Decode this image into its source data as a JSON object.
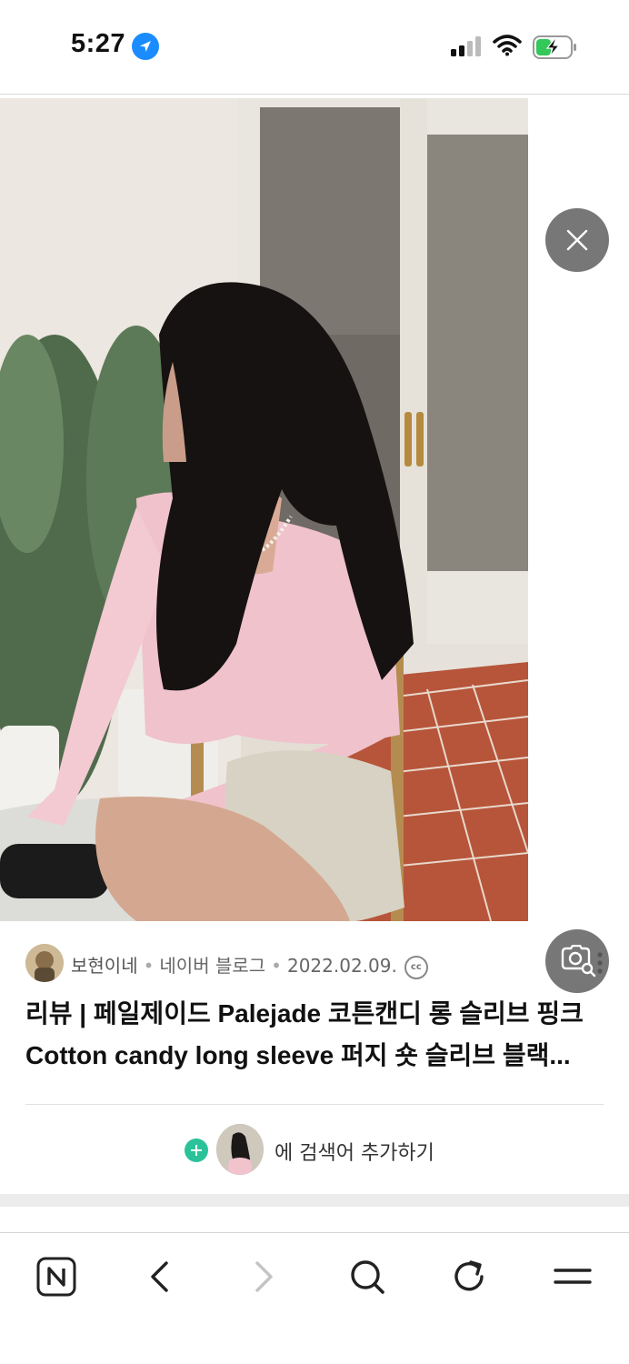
{
  "status_bar": {
    "time": "5:27",
    "icons": [
      "location-arrow-icon",
      "cellular-signal-icon",
      "wifi-icon",
      "battery-charging-icon"
    ]
  },
  "viewer": {
    "close_icon": "close-icon",
    "lens_icon": "image-search-icon"
  },
  "post": {
    "author": "보현이네",
    "source": "네이버 블로그",
    "date": "2022.02.09.",
    "cc_label": "cc",
    "title_line1": "리뷰 | 페일제이드 Palejade 코튼캔디 롱 슬리브 핑크",
    "title_line2": "Cotton candy long sleeve 퍼지 숏 슬리브 블랙...",
    "add_search_label": "에 검색어 추가하기"
  },
  "toolbar": {
    "items": [
      "naver-home-icon",
      "back-icon",
      "forward-icon",
      "search-icon",
      "reload-icon",
      "menu-icon"
    ]
  },
  "colors": {
    "accent_blue": "#1a8cff",
    "plus_green": "#2bc29a",
    "overlay_button": "#777777"
  }
}
